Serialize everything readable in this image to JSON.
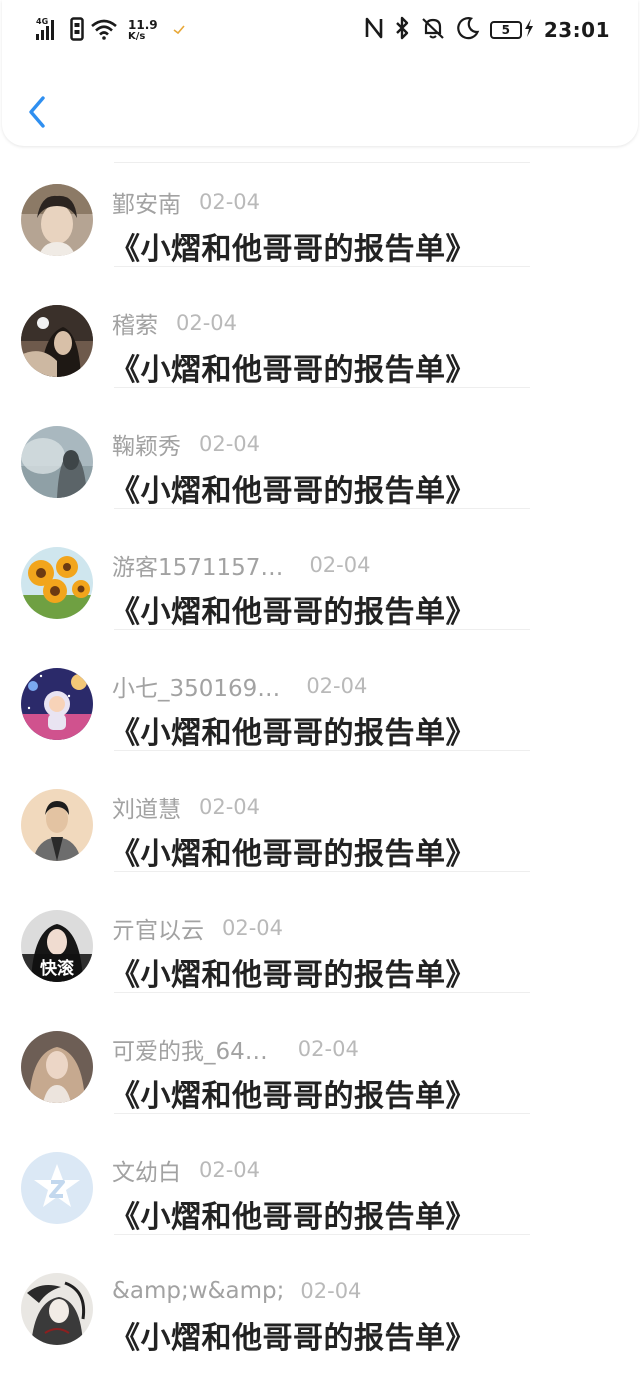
{
  "status_bar": {
    "signal_label": "4G",
    "net_speed_value": "11.9",
    "net_speed_unit": "K/s",
    "battery_level": "5",
    "time": "23:01"
  },
  "header": {
    "back_label": "‹"
  },
  "comments": [
    {
      "user": "鄞安南",
      "date": "02-04",
      "title": "《小熠和他哥哥的报告单》"
    },
    {
      "user": "稽萦",
      "date": "02-04",
      "title": "《小熠和他哥哥的报告单》"
    },
    {
      "user": "鞠颖秀",
      "date": "02-04",
      "title": "《小熠和他哥哥的报告单》"
    },
    {
      "user": "游客1571157…",
      "date": "02-04",
      "title": "《小熠和他哥哥的报告单》"
    },
    {
      "user": "小七_350169…",
      "date": "02-04",
      "title": "《小熠和他哥哥的报告单》"
    },
    {
      "user": "刘道慧",
      "date": "02-04",
      "title": "《小熠和他哥哥的报告单》"
    },
    {
      "user": "亓官以云",
      "date": "02-04",
      "title": "《小熠和他哥哥的报告单》",
      "avatar_text": "快滚"
    },
    {
      "user": "可爱的我_64…",
      "date": "02-04",
      "title": "《小熠和他哥哥的报告单》"
    },
    {
      "user": "文幼白",
      "date": "02-04",
      "title": "《小熠和他哥哥的报告单》"
    },
    {
      "user": "&amp;w&amp;",
      "date": "02-04",
      "title": "《小熠和他哥哥的报告单》"
    }
  ],
  "colors": {
    "accent": "#2f8ff0",
    "username": "#a2a2a2",
    "date": "#b9b9b9",
    "title": "#222222"
  }
}
